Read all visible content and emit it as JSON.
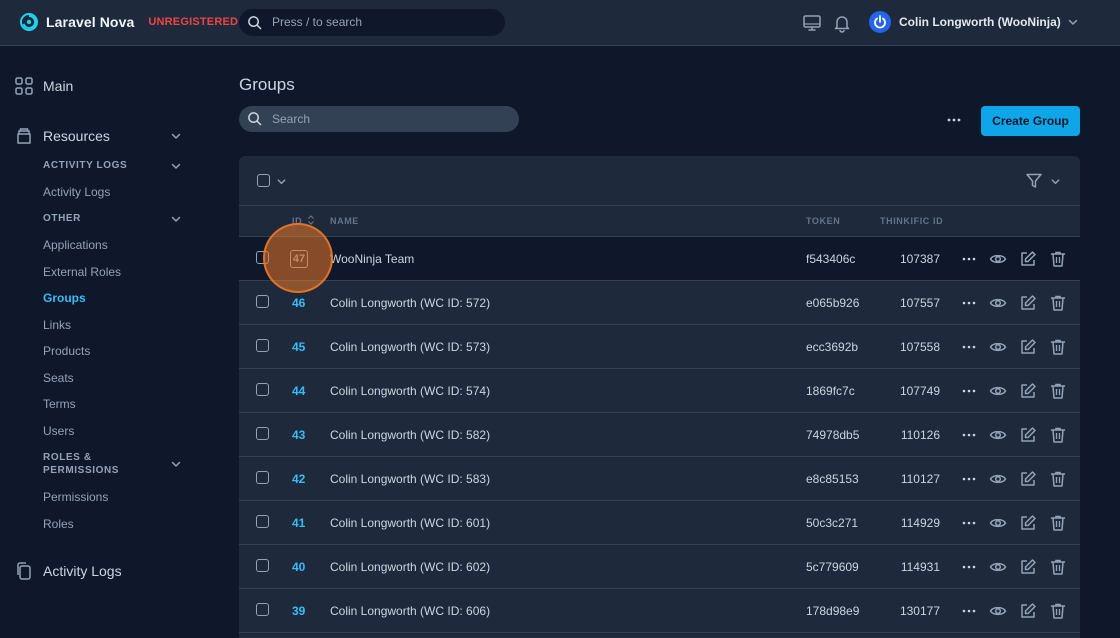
{
  "app": {
    "name": "Laravel Nova",
    "license_badge": "UNREGISTERED",
    "search_placeholder": "Press / to search",
    "user_name": "Colin Longworth (WooNinja)",
    "accent_color": "#0ea5e9",
    "link_color": "#38bdf8",
    "badge_color": "#ef4444"
  },
  "sidebar": {
    "main_label": "Main",
    "resources_label": "Resources",
    "groups": [
      {
        "label": "ACTIVITY LOGS",
        "items": [
          "Activity Logs"
        ]
      },
      {
        "label": "OTHER",
        "items": [
          "Applications",
          "External Roles",
          "Groups",
          "Links",
          "Products",
          "Seats",
          "Terms",
          "Users"
        ]
      },
      {
        "label_line1": "ROLES &",
        "label_line2": "PERMISSIONS",
        "items": [
          "Permissions",
          "Roles"
        ]
      }
    ],
    "active_item": "Groups",
    "activity_logs_label": "Activity Logs"
  },
  "main": {
    "title": "Groups",
    "search_placeholder": "Search",
    "create_button": "Create Group"
  },
  "table": {
    "columns": {
      "id": "ID",
      "name": "NAME",
      "token": "TOKEN",
      "thinkific_id": "THINKIFIC ID"
    },
    "rows": [
      {
        "id": "47",
        "name": "WooNinja Team",
        "token": "f543406c",
        "thinkific_id": "107387"
      },
      {
        "id": "46",
        "name": "Colin Longworth (WC ID: 572)",
        "token": "e065b926",
        "thinkific_id": "107557"
      },
      {
        "id": "45",
        "name": "Colin Longworth (WC ID: 573)",
        "token": "ecc3692b",
        "thinkific_id": "107558"
      },
      {
        "id": "44",
        "name": "Colin Longworth (WC ID: 574)",
        "token": "1869fc7c",
        "thinkific_id": "107749"
      },
      {
        "id": "43",
        "name": "Colin Longworth (WC ID: 582)",
        "token": "74978db5",
        "thinkific_id": "110126"
      },
      {
        "id": "42",
        "name": "Colin Longworth (WC ID: 583)",
        "token": "e8c85153",
        "thinkific_id": "110127"
      },
      {
        "id": "41",
        "name": "Colin Longworth (WC ID: 601)",
        "token": "50c3c271",
        "thinkific_id": "114929"
      },
      {
        "id": "40",
        "name": "Colin Longworth (WC ID: 602)",
        "token": "5c779609",
        "thinkific_id": "114931"
      },
      {
        "id": "39",
        "name": "Colin Longworth (WC ID: 606)",
        "token": "178d98e9",
        "thinkific_id": "130177"
      }
    ]
  }
}
